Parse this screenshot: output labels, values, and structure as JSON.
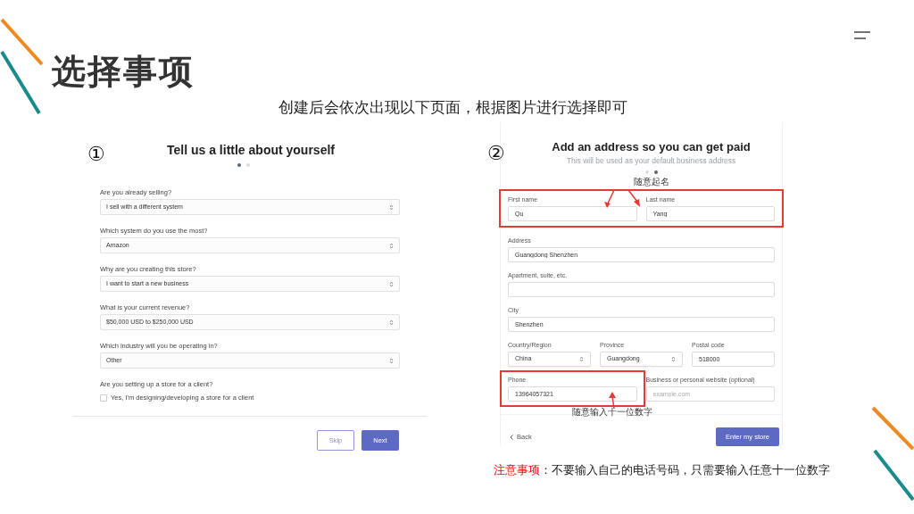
{
  "title": "选择事项",
  "subtitle": "创建后会依次出现以下页面，根据图片进行选择即可",
  "step1": {
    "number": "①",
    "heading": "Tell us a little about yourself",
    "dots": [
      {
        "selected": true
      },
      {
        "selected": false
      }
    ],
    "questions": [
      {
        "label": "Are you already selling?",
        "value": "I sell with a different system"
      },
      {
        "label": "Which system do you use the most?",
        "value": "Amazon"
      },
      {
        "label": "Why are you creating this store?",
        "value": "I want to start a new business"
      },
      {
        "label": "What is your current revenue?",
        "value": "$50,000 USD to $250,000 USD"
      },
      {
        "label": "Which industry will you be operating in?",
        "value": "Other"
      }
    ],
    "checkbox": {
      "question": "Are you setting up a store for a client?",
      "label": "Yes, I'm designing/developing a store for a client",
      "checked": false
    },
    "buttons": [
      {
        "label": "Skip",
        "kind": "secondary"
      },
      {
        "label": "Next",
        "kind": "primary"
      }
    ]
  },
  "step2": {
    "number": "②",
    "heading": "Add an address so you can get paid",
    "subheading": "This will be used as your default business address",
    "dots": [
      {
        "selected": false
      },
      {
        "selected": true
      }
    ],
    "name_note": "随意起名",
    "rows": [
      {
        "highlighted": true,
        "fields": [
          {
            "kind": "text",
            "label": "First name",
            "value": "Qu"
          },
          {
            "kind": "text",
            "label": "Last name",
            "value": "Yang"
          }
        ]
      },
      {
        "highlighted": false,
        "fields": [
          {
            "kind": "text",
            "label": "Address",
            "value": "Guangdong Shenzhen"
          }
        ]
      },
      {
        "highlighted": false,
        "fields": [
          {
            "kind": "text",
            "label": "Apartment, suite, etc."
          }
        ]
      },
      {
        "highlighted": false,
        "fields": [
          {
            "kind": "text",
            "label": "City",
            "value": "Shenzhen"
          }
        ]
      },
      {
        "highlighted": false,
        "fields": [
          {
            "kind": "select",
            "label": "Country/Region",
            "value": "China"
          },
          {
            "kind": "select",
            "label": "Province",
            "value": "Guangdong"
          },
          {
            "kind": "text",
            "label": "Postal code",
            "value": "518000"
          }
        ]
      },
      {
        "highlighted": false,
        "fields": [
          {
            "kind": "text",
            "label": "Phone",
            "value": "13964057321",
            "highlighted": true
          },
          {
            "kind": "text",
            "label": "Business or personal website (optional)",
            "placeholder": "example.com"
          }
        ]
      }
    ],
    "phone_note": "随意输入十一位数字",
    "back": "Back",
    "submit": "Enter my store"
  },
  "note": {
    "label": "注意事项",
    "text": "：不要输入自己的电话号码，只需要输入任意十一位数字"
  }
}
